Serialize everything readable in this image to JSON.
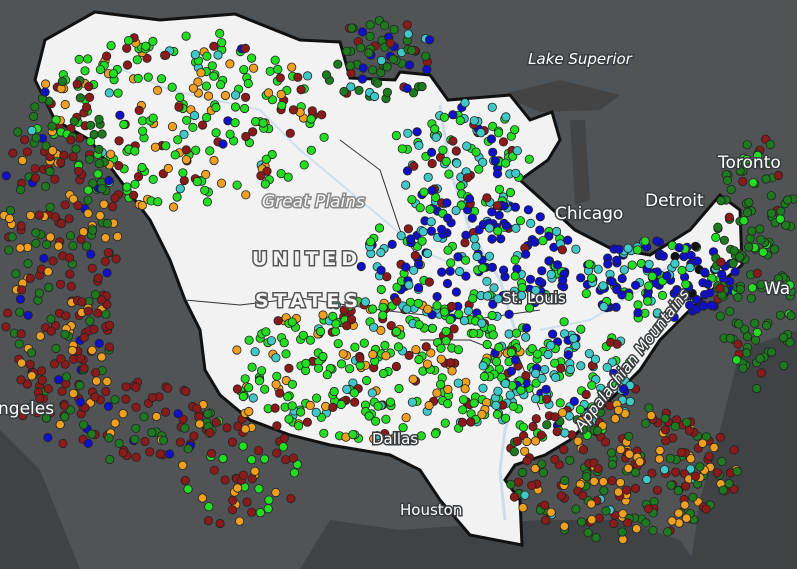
{
  "map": {
    "labels": {
      "lake_superior": "Lake Superior",
      "toronto": "Toronto",
      "detroit": "Detroit",
      "chicago": "Chicago",
      "great_plains": "Great Plains",
      "united": "UNITED",
      "states": "STATES",
      "st_louis": "St. Louis",
      "appalachian": "Appalachian Mountains",
      "los_angeles_partial": "ngeles",
      "dallas": "Dallas",
      "houston": "Houston",
      "washington_partial": "Wa"
    },
    "colors": {
      "basin_fill": "#f2f2f2",
      "basin_outline": "#111111",
      "land": "#4f5356",
      "water": "#3d4144",
      "green": "#22dd22",
      "dark_red": "#8b1a1a",
      "orange": "#f0a020",
      "cyan": "#40c8c8",
      "blue": "#1010c8",
      "dark_green": "#1e7a1e",
      "black": "#111111"
    }
  }
}
